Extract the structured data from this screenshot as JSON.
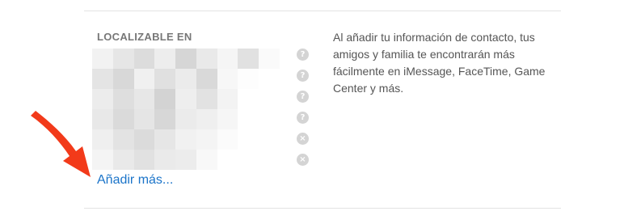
{
  "section": {
    "title": "LOCALIZABLE EN",
    "add_more_label": "Añadir más...",
    "description": "Al añadir tu información de contacto, tus amigos y familia te encontrarán más fácilmente en iMessage, FaceTime, Game Center y más."
  },
  "entries": [
    {
      "status_icon": "help-icon",
      "glyph": "?"
    },
    {
      "status_icon": "help-icon",
      "glyph": "?"
    },
    {
      "status_icon": "help-icon",
      "glyph": "?"
    },
    {
      "status_icon": "help-icon",
      "glyph": "?"
    },
    {
      "status_icon": "remove-icon",
      "glyph": "×"
    },
    {
      "status_icon": "remove-icon",
      "glyph": "×"
    }
  ],
  "colors": {
    "link": "#1b74c9",
    "arrow": "#f23a1a",
    "status_icon_bg": "#d4d4d4"
  },
  "annotation": {
    "icon": "red-arrow-icon"
  }
}
